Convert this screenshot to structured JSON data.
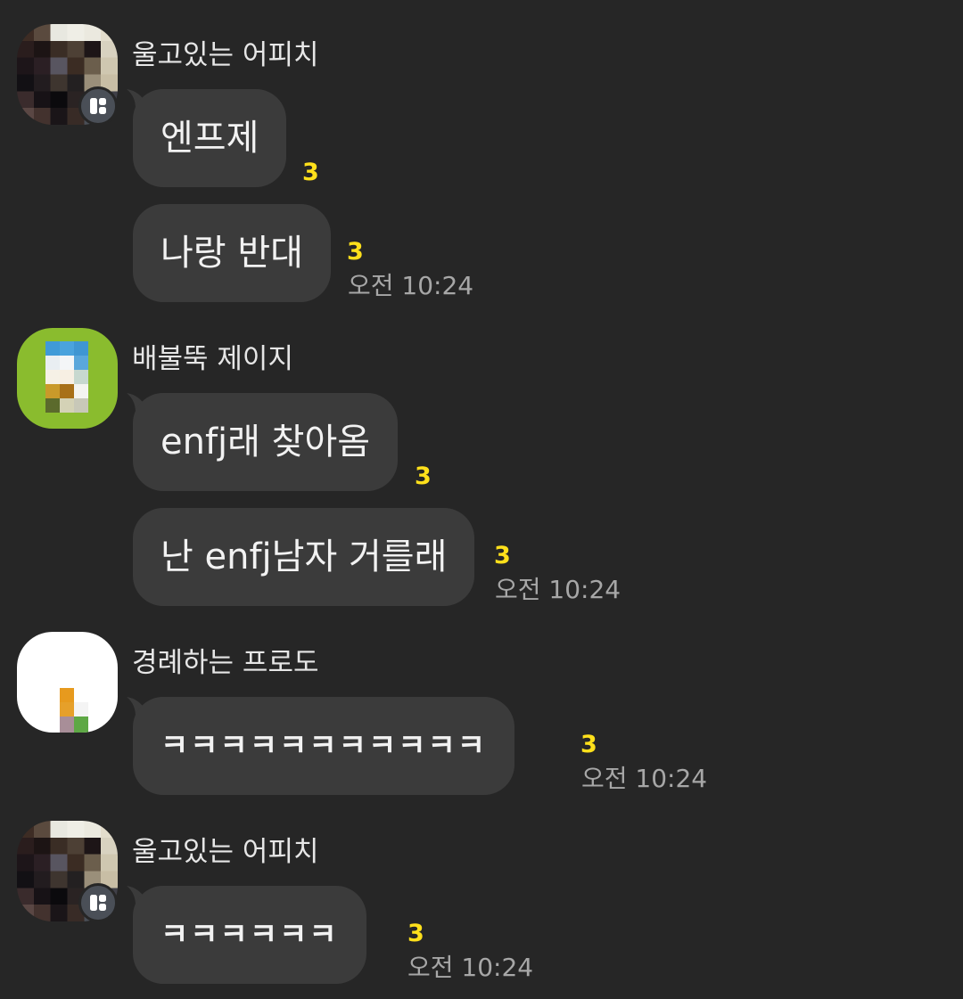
{
  "groups": [
    {
      "sender": "울고있는 어피치",
      "avatar": "pixelated-dark-avatar",
      "messages": [
        {
          "text": "엔프제",
          "unread": "3",
          "time": ""
        },
        {
          "text": "나랑 반대",
          "unread": "3",
          "time": "오전 10:24"
        }
      ]
    },
    {
      "sender": "배불뚝 제이지",
      "avatar": "pixelated-green-avatar",
      "messages": [
        {
          "text": "enfj래 찾아옴",
          "unread": "3",
          "time": ""
        },
        {
          "text": "난 enfj남자 거를래",
          "unread": "3",
          "time": "오전 10:24"
        }
      ]
    },
    {
      "sender": "경례하는 프로도",
      "avatar": "pixelated-white-avatar",
      "messages": [
        {
          "text": "ㅋㅋㅋㅋㅋㅋㅋㅋㅋㅋㅋ",
          "unread": "3",
          "time": "오전 10:24"
        }
      ]
    },
    {
      "sender": "울고있는 어피치",
      "avatar": "pixelated-dark-avatar",
      "messages": [
        {
          "text": "ㅋㅋㅋㅋㅋㅋ",
          "unread": "3",
          "time": "오전 10:24"
        }
      ]
    }
  ],
  "colors": {
    "background": "#262626",
    "bubble": "#3b3b3b",
    "unread": "#ffe01b",
    "time": "#a7a7a7"
  }
}
